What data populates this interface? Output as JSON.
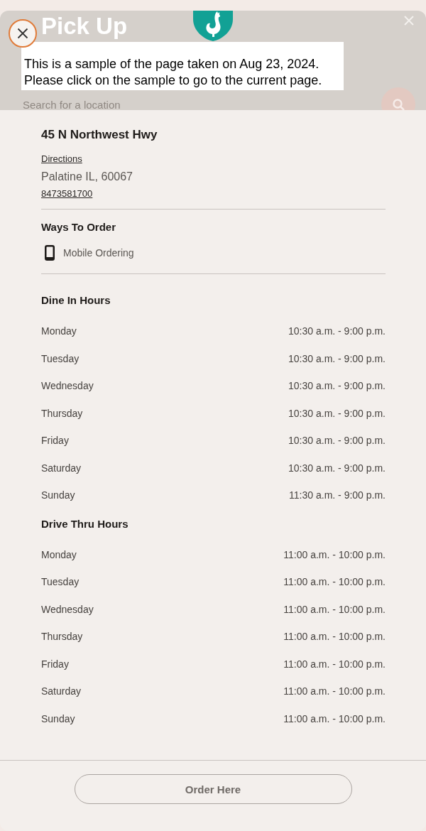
{
  "background_page": {
    "title": "Pick Up",
    "search": {
      "placeholder": "Search for a location"
    }
  },
  "sample_notice": {
    "lines": [
      "This is a sample of the page taken on Aug 23, 2024.",
      "Please click on the sample to go to the current page."
    ]
  },
  "location": {
    "name": "45 N Northwest Hwy",
    "directions_link": "Directions",
    "city_line": "Palatine IL, 60067",
    "phone": "8473581700"
  },
  "ways_to_order": {
    "heading": "Ways To Order",
    "items": [
      {
        "label": "Mobile Ordering"
      }
    ]
  },
  "hours_sections": [
    {
      "heading": "Dine In Hours",
      "rows": [
        {
          "day": "Monday",
          "hours": "10:30 a.m. - 9:00 p.m."
        },
        {
          "day": "Tuesday",
          "hours": "10:30 a.m. - 9:00 p.m."
        },
        {
          "day": "Wednesday",
          "hours": "10:30 a.m. - 9:00 p.m."
        },
        {
          "day": "Thursday",
          "hours": "10:30 a.m. - 9:00 p.m."
        },
        {
          "day": "Friday",
          "hours": "10:30 a.m. - 9:00 p.m."
        },
        {
          "day": "Saturday",
          "hours": "10:30 a.m. - 9:00 p.m."
        },
        {
          "day": "Sunday",
          "hours": "11:30 a.m. - 9:00 p.m."
        }
      ]
    },
    {
      "heading": "Drive Thru Hours",
      "rows": [
        {
          "day": "Monday",
          "hours": "11:00 a.m. - 10:00 p.m."
        },
        {
          "day": "Tuesday",
          "hours": "11:00 a.m. - 10:00 p.m."
        },
        {
          "day": "Wednesday",
          "hours": "11:00 a.m. - 10:00 p.m."
        },
        {
          "day": "Thursday",
          "hours": "11:00 a.m. - 10:00 p.m."
        },
        {
          "day": "Friday",
          "hours": "11:00 a.m. - 10:00 p.m."
        },
        {
          "day": "Saturday",
          "hours": "11:00 a.m. - 10:00 p.m."
        },
        {
          "day": "Sunday",
          "hours": "11:00 a.m. - 10:00 p.m."
        }
      ]
    }
  ],
  "order_button": "Order Here"
}
